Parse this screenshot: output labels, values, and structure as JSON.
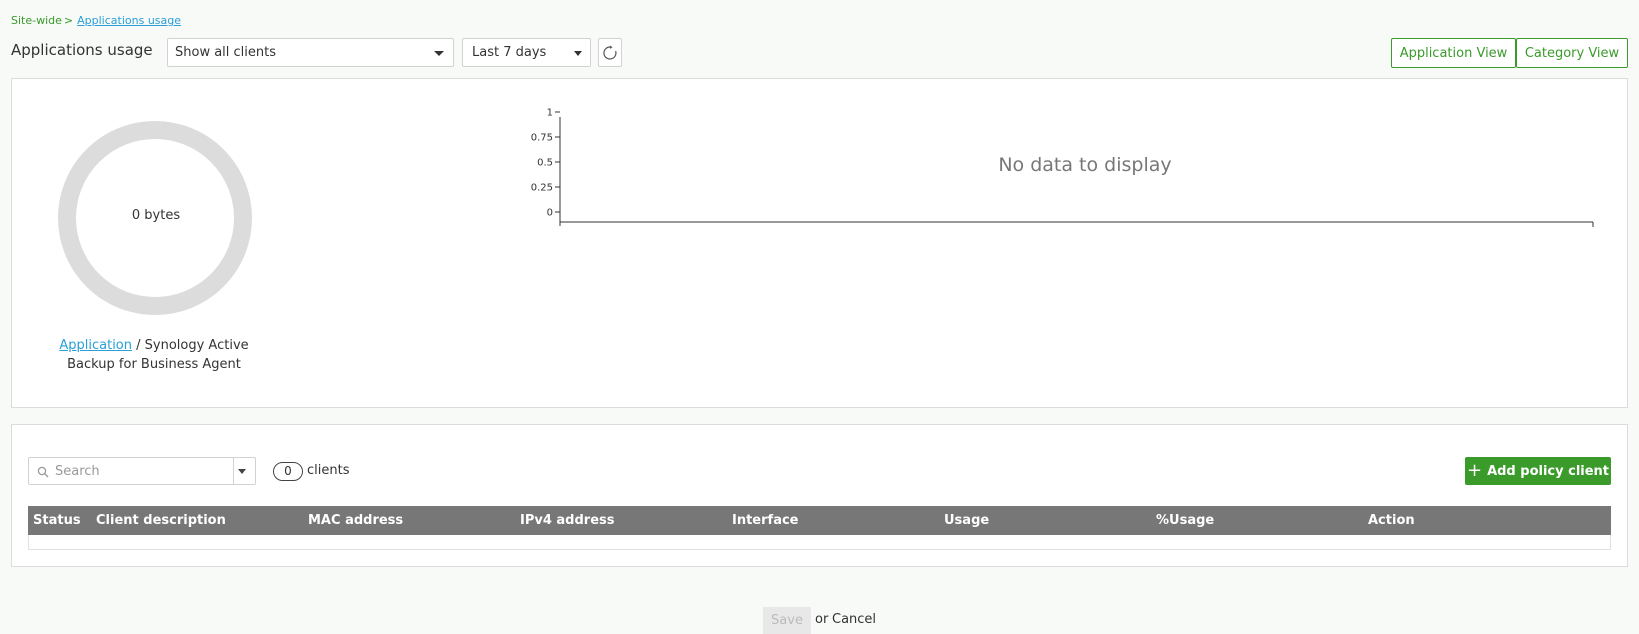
{
  "breadcrumb": {
    "root": "Site-wide",
    "separator": ">",
    "current": "Applications usage"
  },
  "page_title": "Applications usage",
  "filters": {
    "client_select": "Show all clients",
    "range_select": "Last 7 days"
  },
  "view_buttons": {
    "application": "Application View",
    "category": "Category View"
  },
  "donut": {
    "center_label": "0 bytes",
    "value_bytes": 0
  },
  "app_caption": {
    "link": "Application",
    "text": " / Synology Active Backup for Business Agent"
  },
  "chart_data": {
    "type": "line",
    "y_ticks": [
      "1",
      "0.75",
      "0.5",
      "0.25",
      "0"
    ],
    "ylim": [
      0,
      1
    ],
    "series": [],
    "empty_message": "No data to display"
  },
  "clients": {
    "search_placeholder": "Search",
    "count": "0",
    "count_label": "clients",
    "add_button": "Add policy client"
  },
  "table": {
    "columns": [
      "Status",
      "Client description",
      "MAC address",
      "IPv4 address",
      "Interface",
      "Usage",
      "%Usage",
      "Action"
    ],
    "rows": []
  },
  "footer": {
    "save": "Save",
    "or": "or",
    "cancel": "Cancel"
  },
  "colors": {
    "accent": "#3a9a2a",
    "link": "#2a9fd8",
    "header_bg": "#777777",
    "donut_ring": "#dcdcdc"
  }
}
